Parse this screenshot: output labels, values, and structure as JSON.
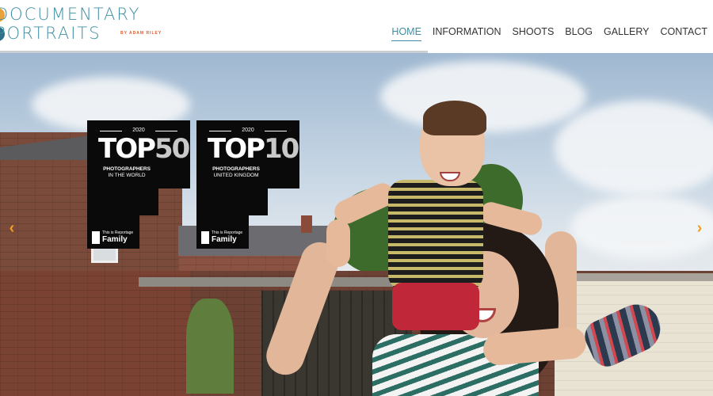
{
  "logo": {
    "line1": "DOCUMENTARY",
    "line2": "PORTRAITS",
    "byline": "BY ADAM RILEY"
  },
  "nav": {
    "items": [
      {
        "label": "HOME",
        "active": true
      },
      {
        "label": "INFORMATION",
        "active": false
      },
      {
        "label": "SHOOTS",
        "active": false
      },
      {
        "label": "BLOG",
        "active": false
      },
      {
        "label": "GALLERY",
        "active": false
      },
      {
        "label": "CONTACT",
        "active": false
      }
    ]
  },
  "slider": {
    "progress": 0.6,
    "prev_icon": "chevron-left-icon",
    "next_icon": "chevron-right-icon",
    "prev_glyph": "‹",
    "next_glyph": "›"
  },
  "badges": [
    {
      "year": "2020",
      "rank_word": "TOP",
      "rank_num": "50",
      "line1": "PHOTOGRAPHERS",
      "line2": "IN THE WORLD",
      "brand_small": "This is Reportage",
      "brand_name": "Family"
    },
    {
      "year": "2020",
      "rank_word": "TOP",
      "rank_num": "10",
      "line1": "PHOTOGRAPHERS",
      "line2": "UNITED KINGDOM",
      "brand_small": "This is Reportage",
      "brand_name": "Family"
    }
  ],
  "colors": {
    "accent": "#3f8fa3",
    "arrow": "#f0a020",
    "badge_bg": "#0a0a0a"
  }
}
